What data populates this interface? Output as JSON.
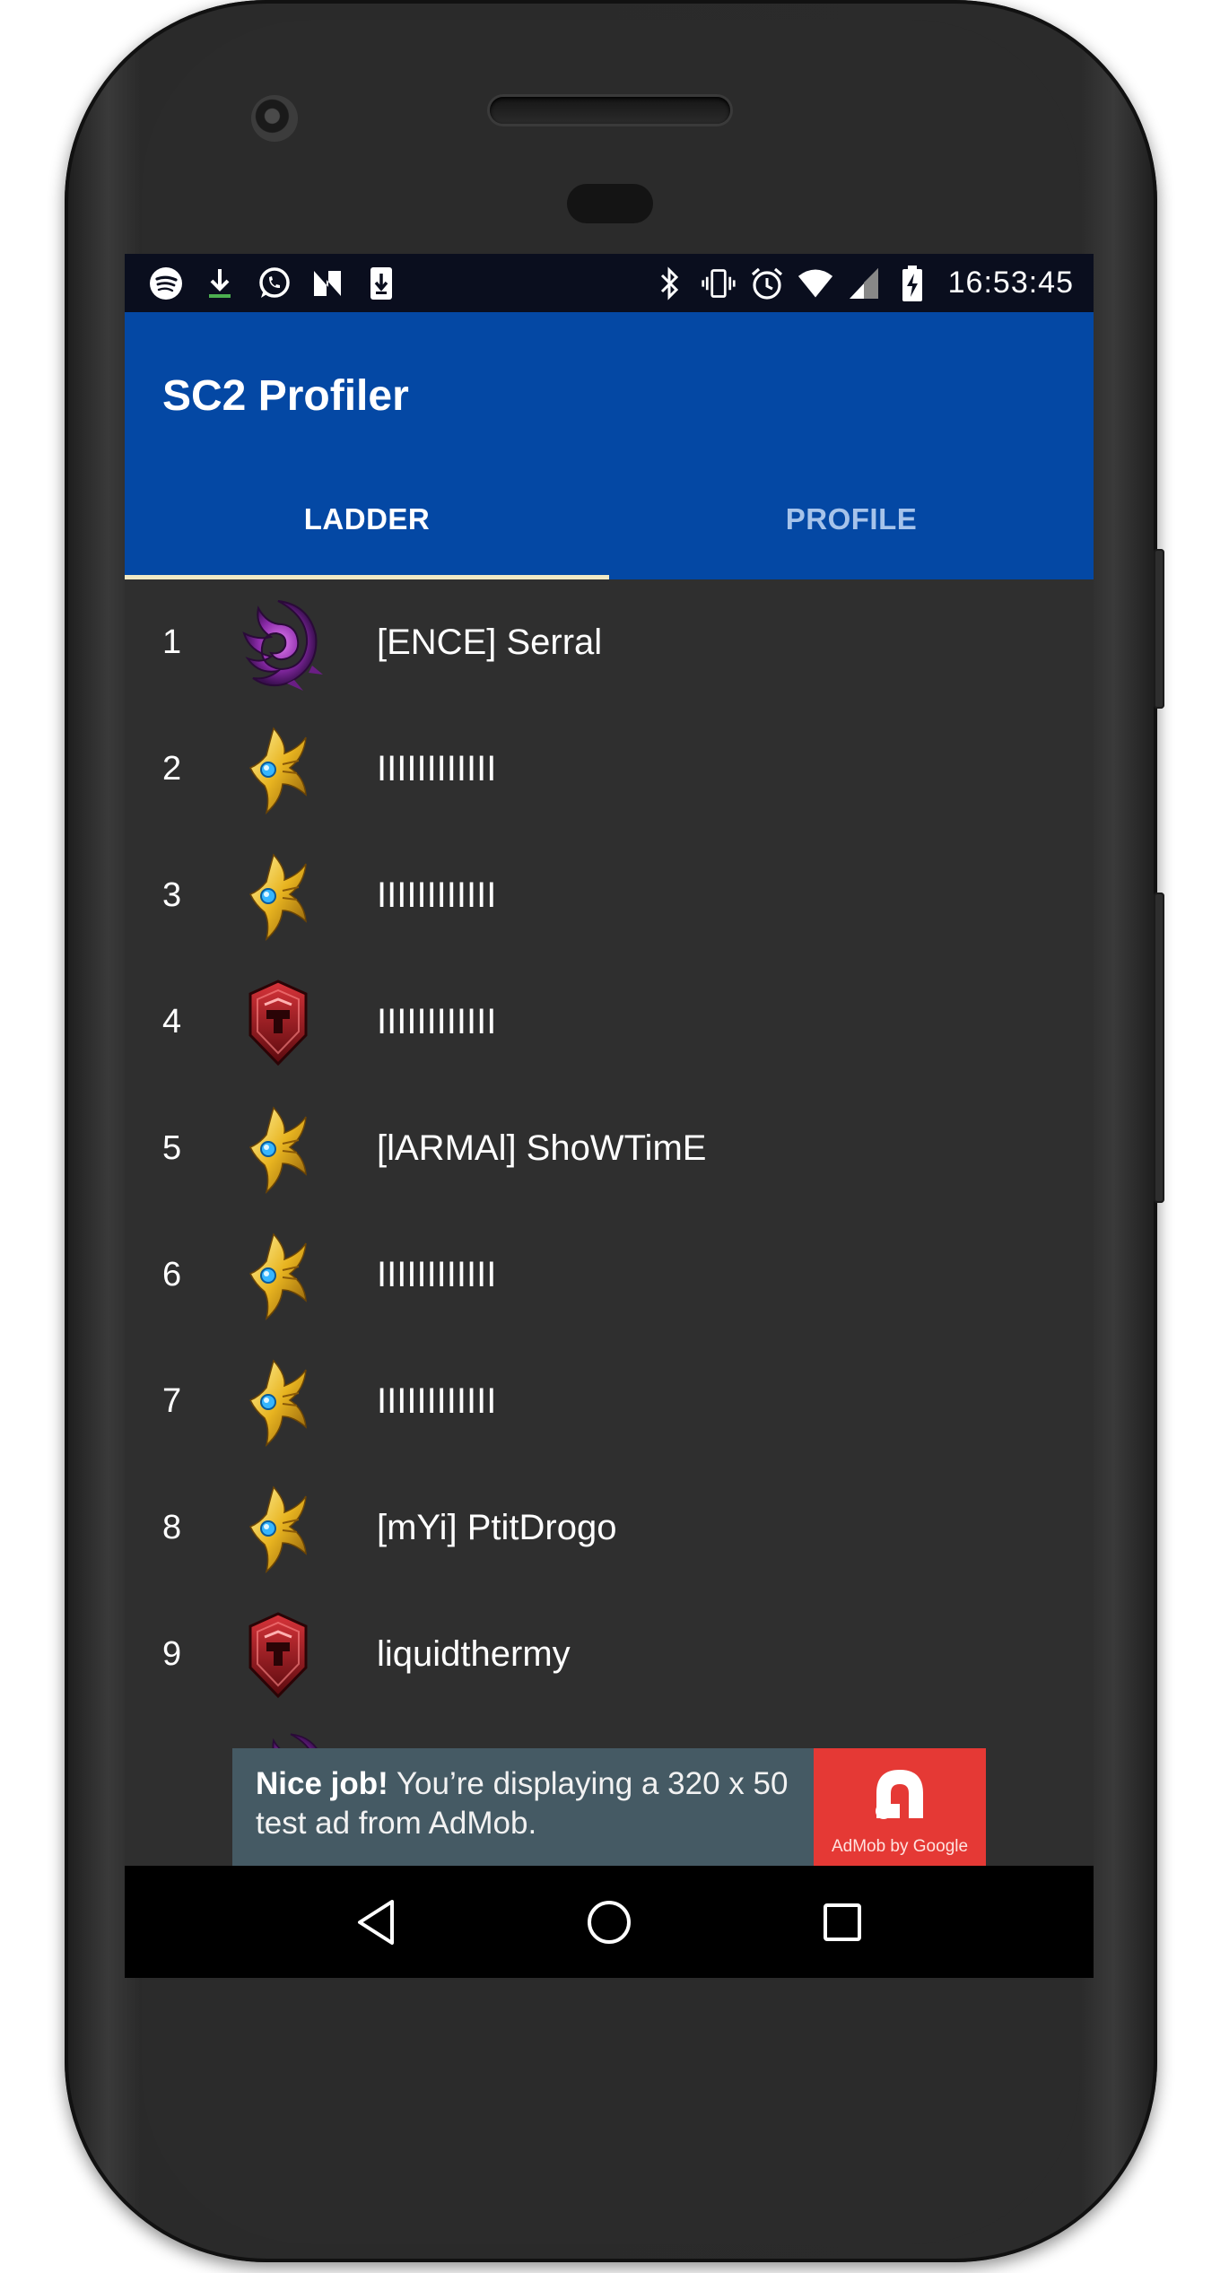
{
  "status_bar": {
    "left_icons": [
      "spotify-icon",
      "download-icon",
      "whatsapp-icon",
      "n-app-icon",
      "sd-card-download-icon"
    ],
    "right_icons": [
      "bluetooth-icon",
      "vibrate-icon",
      "alarm-icon",
      "wifi-icon",
      "signal-icon",
      "battery-charging-icon"
    ],
    "time": "16:53:45"
  },
  "app_bar": {
    "title": "SC2 Profiler",
    "color": "#0448a4"
  },
  "tabs": [
    {
      "label": "LADDER",
      "active": true
    },
    {
      "label": "PROFILE",
      "active": false
    }
  ],
  "ladder": [
    {
      "rank": "1",
      "race": "zerg-icon",
      "name": "[ENCE] Serral"
    },
    {
      "rank": "2",
      "race": "protoss-icon",
      "name": "IIIIIIIIIIII"
    },
    {
      "rank": "3",
      "race": "protoss-icon",
      "name": "IIIIIIIIIIII"
    },
    {
      "rank": "4",
      "race": "terran-icon",
      "name": "IIIIIIIIIIII"
    },
    {
      "rank": "5",
      "race": "protoss-icon",
      "name": "[lARMAl] ShoWTimE"
    },
    {
      "rank": "6",
      "race": "protoss-icon",
      "name": "IIIIIIIIIIII"
    },
    {
      "rank": "7",
      "race": "protoss-icon",
      "name": "IIIIIIIIIIII"
    },
    {
      "rank": "8",
      "race": "protoss-icon",
      "name": "[mYi] PtitDrogo"
    },
    {
      "rank": "9",
      "race": "terran-icon",
      "name": "liquidthermy"
    }
  ],
  "ad_banner": {
    "headline": "Nice job!",
    "body": " You’re displaying a 320 x 50 test ad from AdMob.",
    "logo_caption": "AdMob by Google",
    "background": "#455a64",
    "logo_color": "#e53935"
  },
  "nav_bar": {
    "buttons": [
      "back-icon",
      "home-icon",
      "recents-icon"
    ]
  }
}
